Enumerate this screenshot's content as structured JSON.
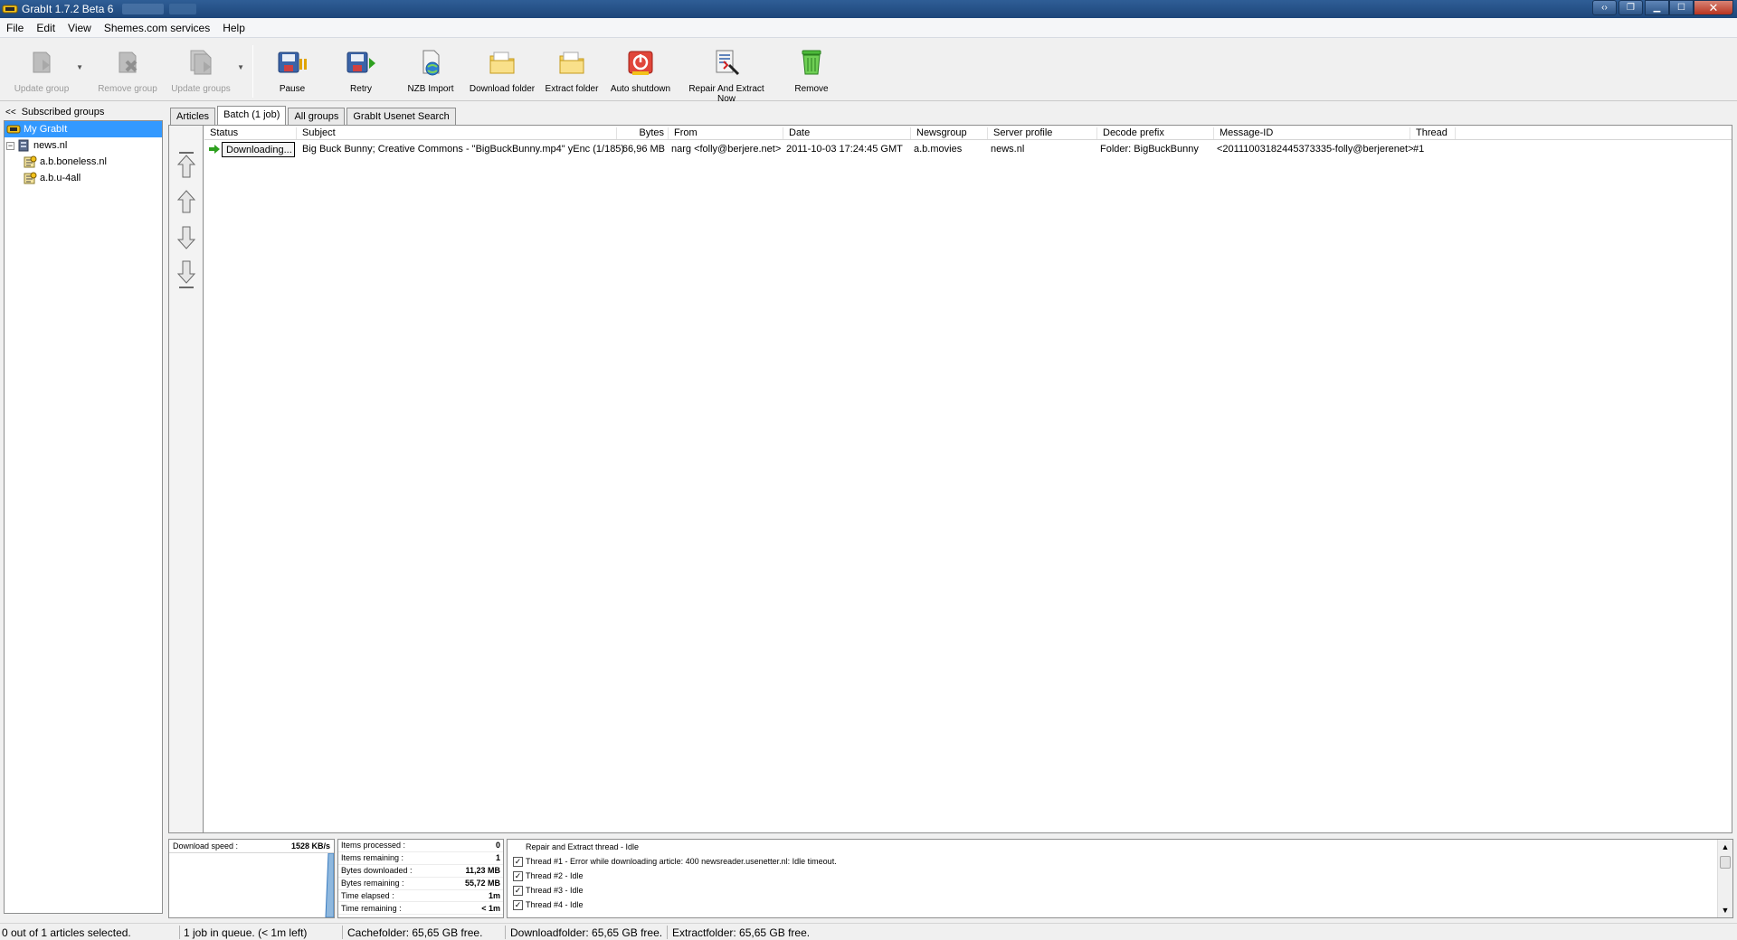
{
  "window": {
    "title": "GrabIt 1.7.2 Beta 6"
  },
  "menu": [
    "File",
    "Edit",
    "View",
    "Shemes.com services",
    "Help"
  ],
  "toolbar": {
    "update_group": "Update group",
    "remove_group": "Remove group",
    "update_groups": "Update groups",
    "pause": "Pause",
    "retry": "Retry",
    "nzb_import": "NZB Import",
    "download_folder": "Download folder",
    "extract_folder": "Extract folder",
    "auto_shutdown": "Auto shutdown",
    "repair_extract": "Repair And Extract Now",
    "remove": "Remove"
  },
  "sidebar": {
    "header_chevron": "<<",
    "header": "Subscribed groups",
    "items": [
      {
        "label": "My GrabIt",
        "selected": true
      },
      {
        "label": "news.nl",
        "expander": "−"
      },
      {
        "label": "a.b.boneless.nl"
      },
      {
        "label": "a.b.u-4all"
      }
    ]
  },
  "tabs": [
    "Articles",
    "Batch (1 job)",
    "All groups",
    "GrabIt Usenet Search"
  ],
  "grid": {
    "columns": [
      "Status",
      "Subject",
      "Bytes",
      "From",
      "Date",
      "Newsgroup",
      "Server profile",
      "Decode prefix",
      "Message-ID",
      "Thread"
    ],
    "rows": [
      {
        "status": "Downloading...",
        "subject": "Big Buck Bunny; Creative Commons - \"BigBuckBunny.mp4\" yEnc (1/185)",
        "bytes": "66,96 MB",
        "from": "narg <folly@berjere.net>",
        "date": "2011-10-03 17:24:45 GMT",
        "newsgroup": "a.b.movies",
        "server": "news.nl",
        "decode": "Folder: BigBuckBunny",
        "message_id": "<20111003182445373335-folly@berjerenet>",
        "thread": "#1"
      }
    ]
  },
  "speed": {
    "label": "Download speed :",
    "value": "1528 KB/s"
  },
  "stats": [
    {
      "label": "Items processed :",
      "value": "0"
    },
    {
      "label": "Items remaining :",
      "value": "1"
    },
    {
      "label": "Bytes downloaded :",
      "value": "11,23 MB"
    },
    {
      "label": "Bytes remaining :",
      "value": "55,72 MB"
    },
    {
      "label": "Time elapsed :",
      "value": "1m"
    },
    {
      "label": "Time remaining :",
      "value": "< 1m"
    }
  ],
  "threads": [
    {
      "text": "Repair and Extract thread - Idle",
      "checkbox": false
    },
    {
      "text": "Thread #1 - Error while downloading article: 400 newsreader.usenetter.nl: Idle timeout.",
      "checkbox": true
    },
    {
      "text": "Thread #2 - Idle",
      "checkbox": true
    },
    {
      "text": "Thread #3 - Idle",
      "checkbox": true
    },
    {
      "text": "Thread #4 - Idle",
      "checkbox": true
    }
  ],
  "statusbar": {
    "selection": "0 out of 1 articles selected.",
    "queue": "1 job in queue. (< 1m left)",
    "cache": "Cachefolder: 65,65 GB free.",
    "download": "Downloadfolder: 65,65 GB free.",
    "extract": "Extractfolder: 65,65 GB free."
  },
  "colors": {
    "titlebar": "#1d467a",
    "selection": "#3399ff",
    "go_arrow": "#2ea01f"
  }
}
